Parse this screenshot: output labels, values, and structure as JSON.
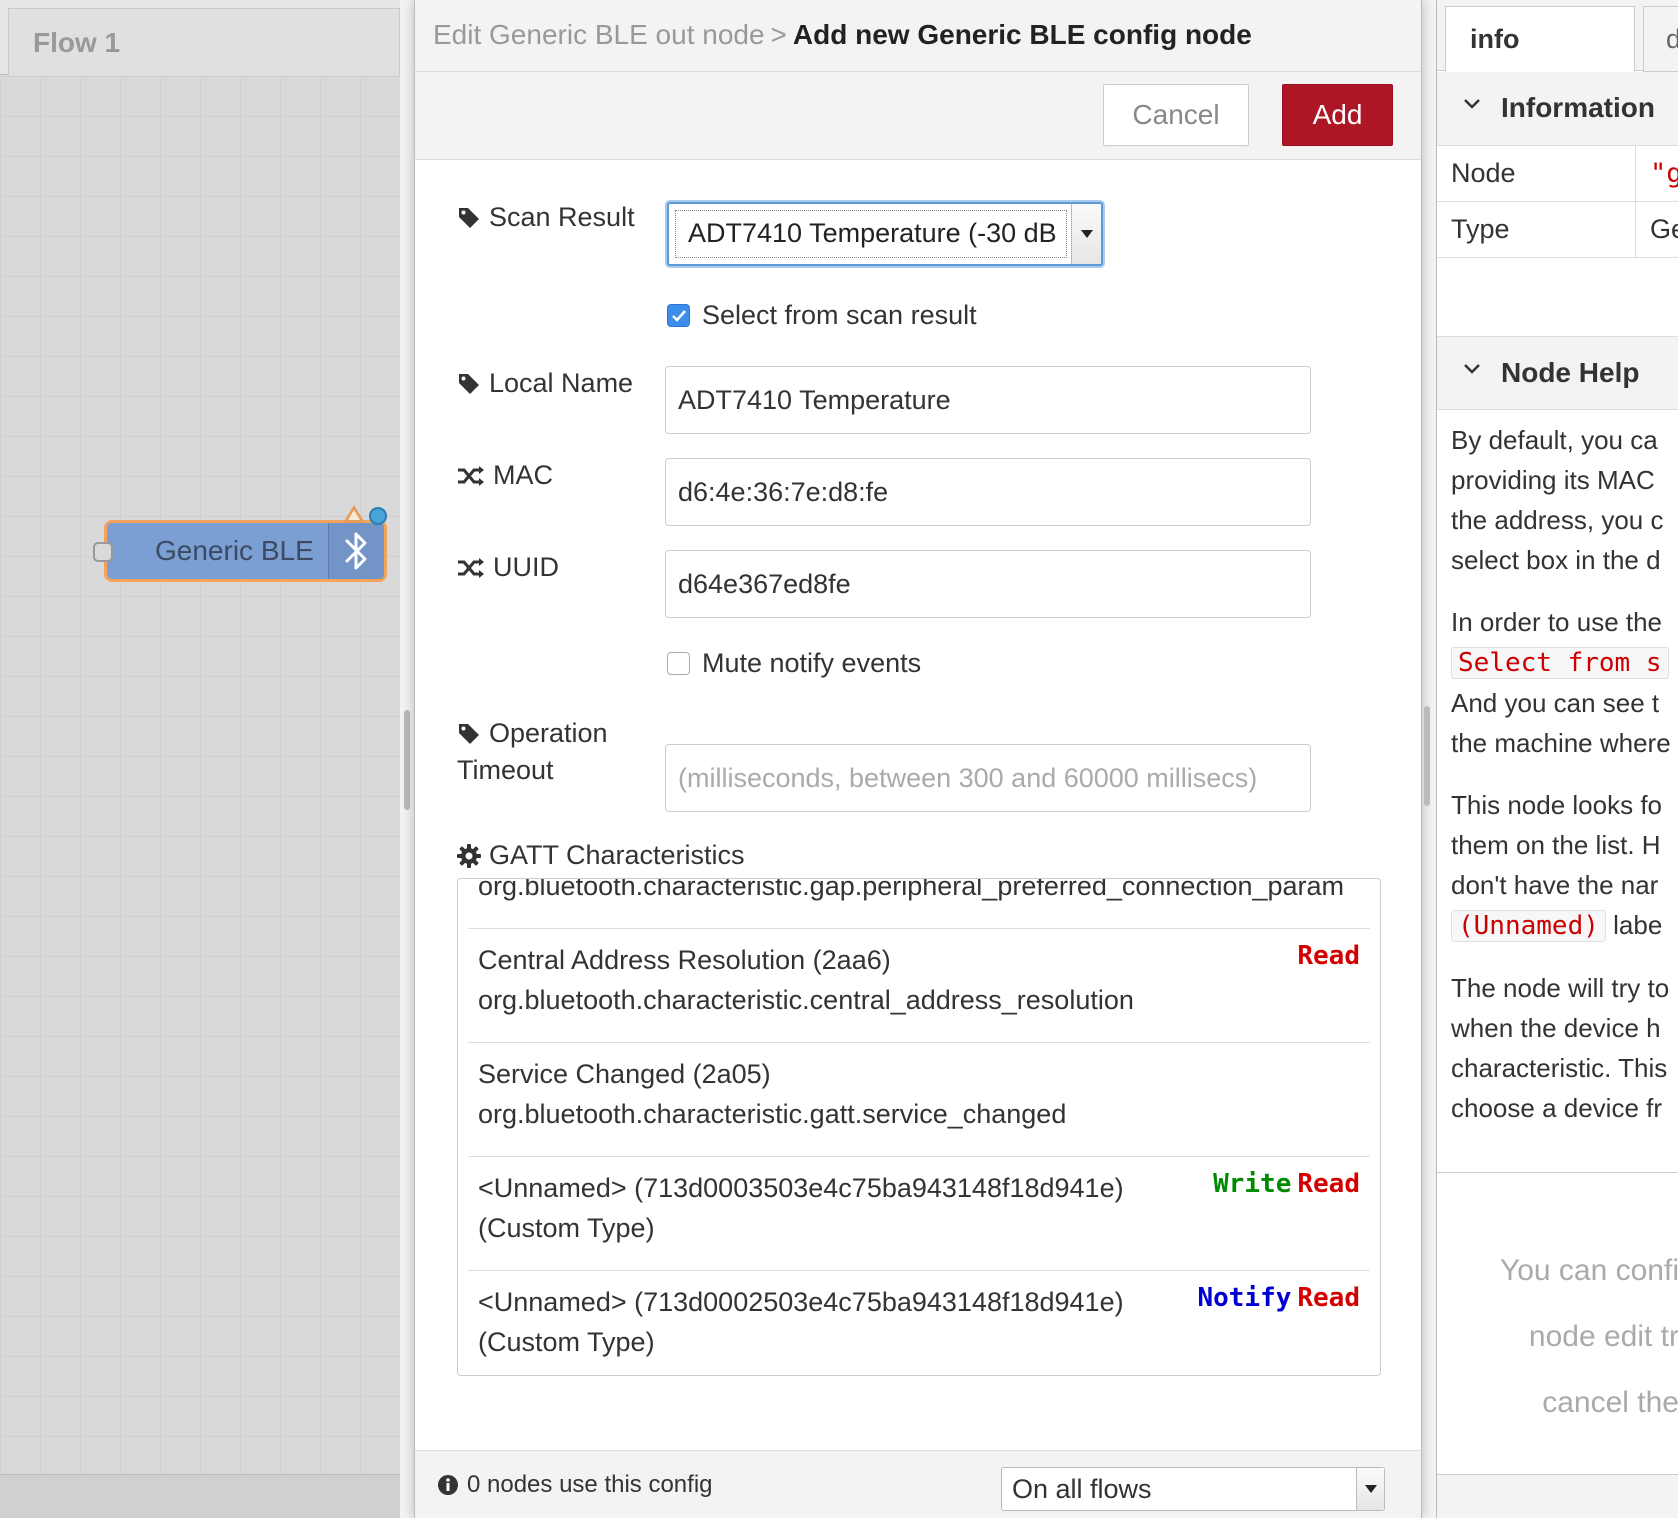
{
  "workspace": {
    "tab_label": "Flow 1",
    "node": {
      "label": "Generic BLE"
    }
  },
  "tray": {
    "breadcrumb_parent": "Edit Generic BLE out node",
    "breadcrumb_sep": ">",
    "breadcrumb_current": "Add new Generic BLE config node",
    "cancel_label": "Cancel",
    "add_label": "Add",
    "form": {
      "scan_result_label": "Scan Result",
      "scan_result_value": "ADT7410 Temperature (-30 dB",
      "select_from_scan_label": "Select from scan result",
      "select_from_scan_checked": true,
      "local_name_label": "Local Name",
      "local_name_value": "ADT7410 Temperature",
      "mac_label": "MAC",
      "mac_value": "d6:4e:36:7e:d8:fe",
      "uuid_label": "UUID",
      "uuid_value": "d64e367ed8fe",
      "mute_notify_label": "Mute notify events",
      "mute_notify_checked": false,
      "timeout_label_1": "Operation",
      "timeout_label_2": "Timeout",
      "timeout_placeholder": "(milliseconds, between 300 and 60000 millisecs)",
      "gatt_label": "GATT Characteristics"
    },
    "gatt_items": [
      {
        "line1": "org.bluetooth.characteristic.gap.peripheral_preferred_connection_param",
        "line2": "",
        "tags": []
      },
      {
        "line1": "Central Address Resolution  (2aa6)",
        "line2": "org.bluetooth.characteristic.central_address_resolution",
        "tags": [
          "Read"
        ]
      },
      {
        "line1": "Service Changed  (2a05)",
        "line2": "org.bluetooth.characteristic.gatt.service_changed",
        "tags": []
      },
      {
        "line1": "<Unnamed>  (713d0003503e4c75ba943148f18d941e)",
        "line2": "(Custom Type)",
        "tags": [
          "Write",
          "Read"
        ]
      },
      {
        "line1": "<Unnamed>  (713d0002503e4c75ba943148f18d941e)",
        "line2": "(Custom Type)",
        "tags": [
          "Notify",
          "Read"
        ]
      }
    ],
    "footer": {
      "usage_text": "0 nodes use this config",
      "scope_value": "On all flows"
    }
  },
  "sidebar": {
    "tab_info": "info",
    "tab_other": "d",
    "info_section_title": "Information",
    "info_rows": [
      {
        "key": "Node",
        "value": "\"g"
      },
      {
        "key": "Type",
        "value": "Ge"
      }
    ],
    "help_section_title": "Node Help",
    "help": {
      "p1_l1": "By default, you ca",
      "p1_l2": "providing its MAC",
      "p1_l3": "the address, you c",
      "p1_l4": "select box in the d",
      "p2_l1": "In order to use the",
      "p2_code": "Select from s",
      "p2_l3": "And you can see t",
      "p2_l4": "the machine where",
      "p3_l1": "This node looks fo",
      "p3_l2": "them on the list. H",
      "p3_l3": "don't have the nar",
      "p3_code": "(Unnamed)",
      "p3_tail": "labe",
      "p4_l1": "The node will try to",
      "p4_l2": "when the device h",
      "p4_l3": "characteristic. This",
      "p4_l4": "choose a device fr"
    },
    "tip_l1": "You can confi",
    "tip_l2": "node edit tr",
    "tip_l3": "cancel the"
  }
}
